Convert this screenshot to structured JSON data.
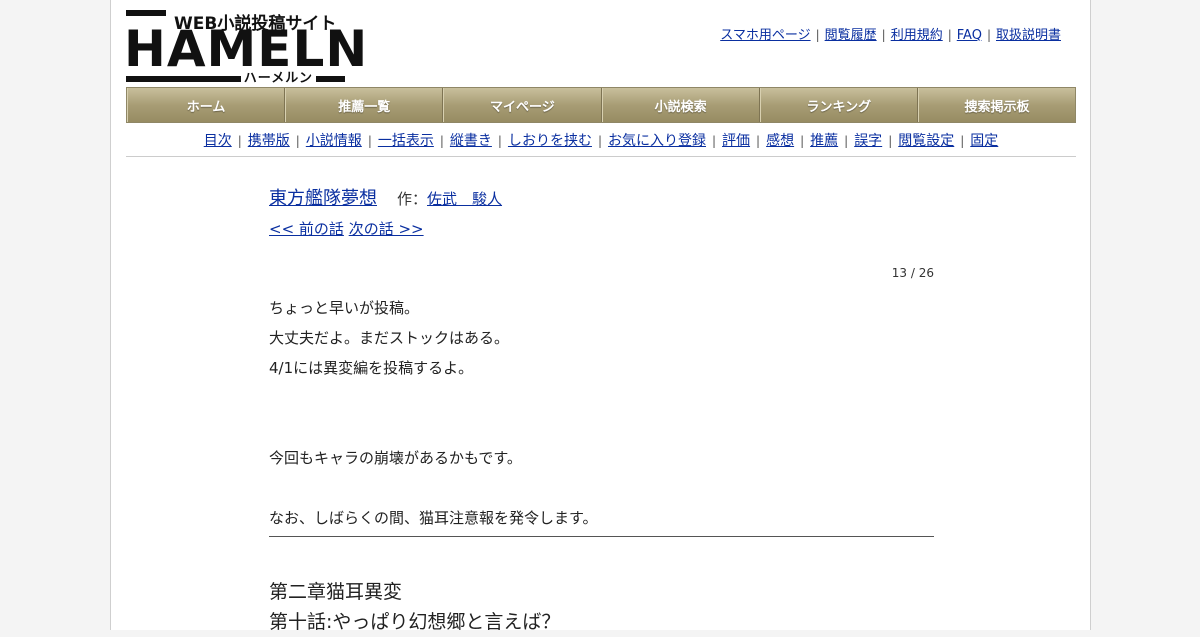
{
  "logo": {
    "tagline": "WEB小説投稿サイト",
    "brand": "HAMELN",
    "kana": "ハーメルン"
  },
  "toplinks": [
    "スマホ用ページ",
    "閲覧履歴",
    "利用規約",
    "FAQ",
    "取扱説明書"
  ],
  "mainnav": [
    "ホーム",
    "推薦一覧",
    "マイページ",
    "小説検索",
    "ランキング",
    "捜索掲示板"
  ],
  "subnav": [
    "目次",
    "携帯版",
    "小説情報",
    "一括表示",
    "縦書き",
    "しおりを挟む",
    "お気に入り登録",
    "評価",
    "感想",
    "推薦",
    "誤字",
    "閲覧設定",
    "固定"
  ],
  "novel": {
    "title": "東方艦隊夢想",
    "author_label": "作：",
    "author": "佐武　駿人",
    "prev": "<< 前の話",
    "next": "次の話 >>",
    "counter": "13 / 26"
  },
  "preface": [
    "ちょっと早いが投稿。",
    "大丈夫だよ。まだストックはある。",
    "4/1には異変編を投稿するよ。",
    "",
    "",
    "今回もキャラの崩壊があるかもです。",
    "",
    "なお、しばらくの間、猫耳注意報を発令します。"
  ],
  "chapter": {
    "section": "第二章猫耳異変",
    "episode": "第十話:やっぱり幻想郷と言えば？"
  }
}
